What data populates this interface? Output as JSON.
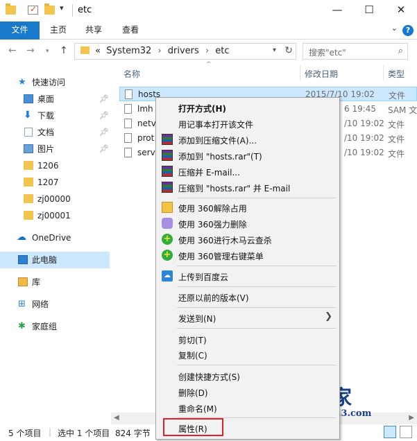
{
  "window": {
    "title": "etc",
    "quick_access_toolbar": [
      "folder-icon",
      "properties-icon",
      "new-folder-icon"
    ],
    "controls": {
      "minimize": "—",
      "maximize": "☐",
      "close": "✕"
    }
  },
  "ribbon": {
    "tabs": [
      "文件",
      "主页",
      "共享",
      "查看"
    ],
    "help": "?"
  },
  "address": {
    "path_prefix": "«",
    "segments": [
      "System32",
      "drivers",
      "etc"
    ],
    "search_placeholder": "搜索\"etc\""
  },
  "nav": {
    "quick_access": "快速访问",
    "items": [
      {
        "label": "桌面",
        "icon": "desktop-icon",
        "pinned": true
      },
      {
        "label": "下载",
        "icon": "download-icon",
        "pinned": true
      },
      {
        "label": "文档",
        "icon": "document-icon",
        "pinned": true
      },
      {
        "label": "图片",
        "icon": "pictures-icon",
        "pinned": true
      },
      {
        "label": "1206",
        "icon": "folder-icon",
        "pinned": false
      },
      {
        "label": "1207",
        "icon": "folder-icon",
        "pinned": false
      },
      {
        "label": "zj00000",
        "icon": "folder-icon",
        "pinned": false
      },
      {
        "label": "zj00001",
        "icon": "folder-icon",
        "pinned": false
      }
    ],
    "onedrive": "OneDrive",
    "this_pc": "此电脑",
    "library": "库",
    "network": "网络",
    "homegroup": "家庭组"
  },
  "columns": {
    "name": "名称",
    "modified": "修改日期",
    "type": "类型"
  },
  "files": [
    {
      "name": "hosts",
      "date": "2015/7/10 19:02",
      "type": "文件",
      "selected": true
    },
    {
      "name": "lmh",
      "date": "6 19:45",
      "type": "SAM 文",
      "selected": false
    },
    {
      "name": "netv",
      "date": "/10 19:02",
      "type": "文件",
      "selected": false
    },
    {
      "name": "prot",
      "date": "/10 19:02",
      "type": "文件",
      "selected": false
    },
    {
      "name": "serv",
      "date": "/10 19:02",
      "type": "文件",
      "selected": false
    }
  ],
  "context_menu": {
    "open_with": "打开方式(H)",
    "open_notepad": "用记事本打开该文件",
    "add_archive": "添加到压缩文件(A)...",
    "add_hosts_rar": "添加到 \"hosts.rar\"(T)",
    "compress_email": "压缩并 E-mail...",
    "compress_hosts_email": "压缩到 \"hosts.rar\" 并 E-mail",
    "unlock_360": "使用 360解除占用",
    "force_delete_360": "使用 360强力删除",
    "trojan_scan_360": "使用 360进行木马云查杀",
    "manage_menu_360": "使用 360管理右键菜单",
    "upload_baidu": "上传到百度云",
    "restore_prev": "还原以前的版本(V)",
    "send_to": "发送到(N)",
    "cut": "剪切(T)",
    "copy": "复制(C)",
    "create_shortcut": "创建快捷方式(S)",
    "delete": "删除(D)",
    "rename": "重命名(M)",
    "properties": "属性(R)"
  },
  "status": {
    "item_count": "5 个项目",
    "selected": "选中 1 个项目",
    "size": "824 字节"
  },
  "watermark": {
    "title": "系统之家",
    "url": "www.Ghost123.com"
  },
  "colors": {
    "accent": "#1979ca",
    "selection": "#cce8ff",
    "highlight_box": "#e0202a"
  }
}
